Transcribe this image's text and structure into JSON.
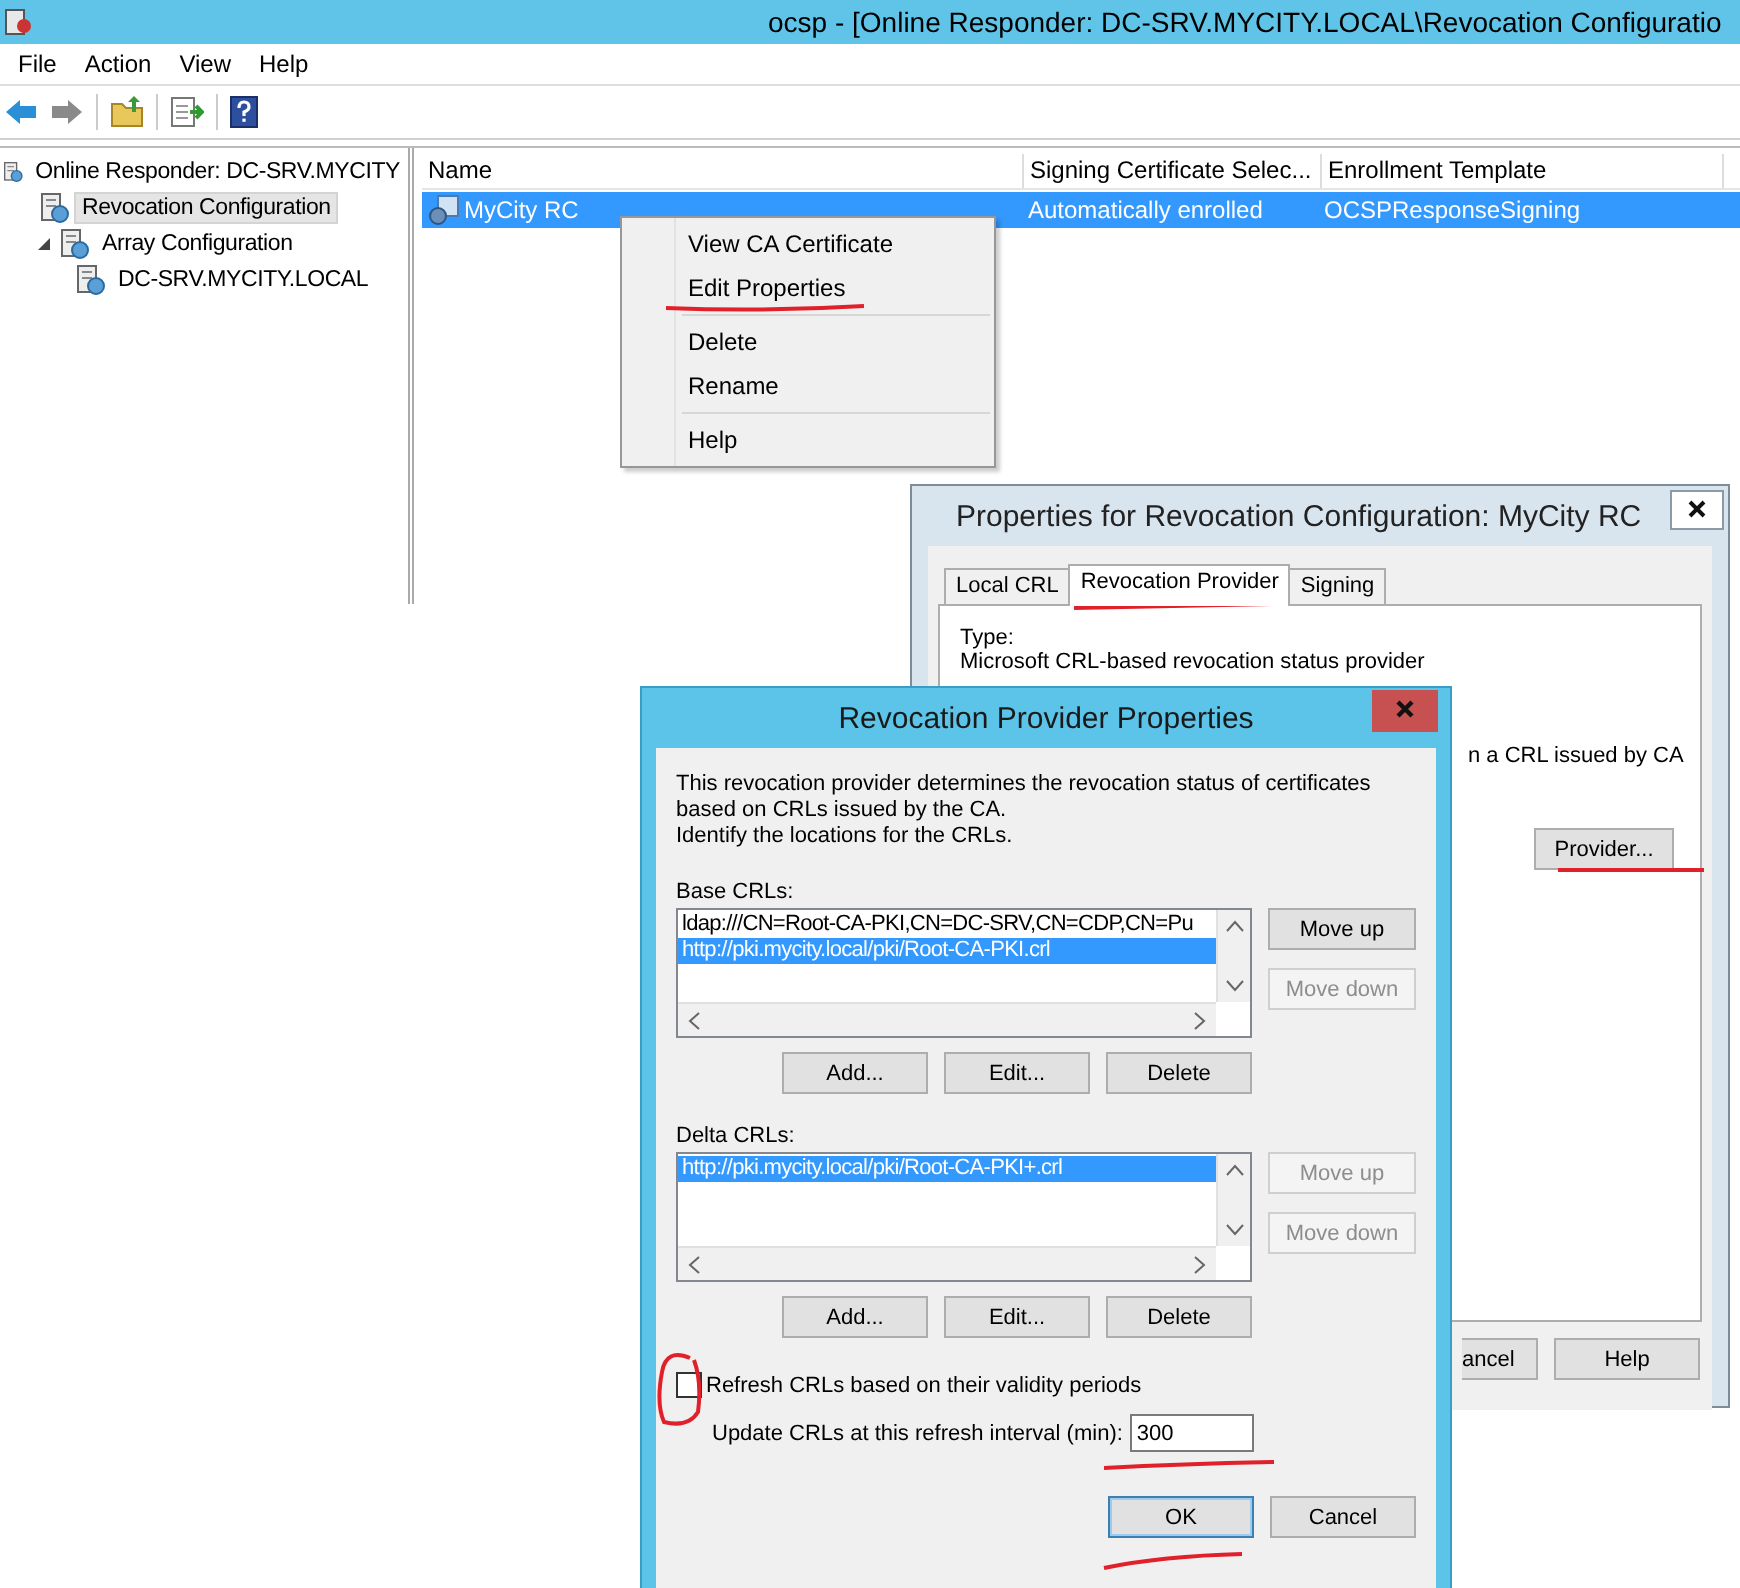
{
  "window": {
    "title": "ocsp - [Online Responder: DC-SRV.MYCITY.LOCAL\\Revocation Configuratio"
  },
  "menu": [
    "File",
    "Action",
    "View",
    "Help"
  ],
  "tree": [
    {
      "label": "Online Responder: DC-SRV.MYCITY",
      "selected": false,
      "children": [
        {
          "label": "Revocation Configuration",
          "selected": true
        },
        {
          "label": "Array Configuration",
          "selected": false,
          "expanded": true,
          "children": [
            {
              "label": "DC-SRV.MYCITY.LOCAL",
              "selected": false
            }
          ]
        }
      ]
    }
  ],
  "table": {
    "columns": [
      "Name",
      "Signing Certificate Selec...",
      "Enrollment Template"
    ],
    "rows": [
      {
        "cells": [
          "MyCity RC",
          "Automatically enrolled",
          "OCSPResponseSigning"
        ],
        "selected": true
      }
    ]
  },
  "context_menu": {
    "groups": [
      [
        "View CA Certificate",
        "Edit Properties"
      ],
      [
        "Delete",
        "Rename"
      ],
      [
        "Help"
      ]
    ]
  },
  "properties_dialog": {
    "title": "Properties for Revocation Configuration: MyCity RC",
    "tabs": [
      {
        "label": "Local CRL",
        "selected": false
      },
      {
        "label": "Revocation Provider",
        "selected": true
      },
      {
        "label": "Signing",
        "selected": false
      }
    ],
    "type_label": "Type:",
    "type_value": "Microsoft CRL-based revocation status provider",
    "partial_text": "n a CRL issued by CA",
    "provider_button": "Provider...",
    "buttons": [
      "ancel",
      "Help"
    ]
  },
  "provider_dialog": {
    "title": "Revocation Provider Properties",
    "description": "This revocation provider determines the revocation status of certificates\nbased on CRLs issued by the CA.\nIdentify the locations for the CRLs.",
    "lists": [
      {
        "label": "Base CRLs:",
        "items": [
          {
            "text": "ldap:///CN=Root-CA-PKI,CN=DC-SRV,CN=CDP,CN=Pu",
            "selected": false
          },
          {
            "text": "http://pki.mycity.local/pki/Root-CA-PKI.crl",
            "selected": true
          }
        ],
        "side_buttons": [
          {
            "label": "Move up",
            "disabled": false
          },
          {
            "label": "Move down",
            "disabled": true
          }
        ],
        "buttons": [
          "Add...",
          "Edit...",
          "Delete"
        ]
      },
      {
        "label": "Delta CRLs:",
        "items": [
          {
            "text": "http://pki.mycity.local/pki/Root-CA-PKI+.crl",
            "selected": true
          }
        ],
        "side_buttons": [
          {
            "label": "Move up",
            "disabled": true
          },
          {
            "label": "Move down",
            "disabled": true
          }
        ],
        "buttons": [
          "Add...",
          "Edit...",
          "Delete"
        ]
      }
    ],
    "refresh_checkbox": {
      "label": "Refresh CRLs based on their validity periods",
      "checked": false
    },
    "interval": {
      "label": "Update CRLs at this refresh interval (min):",
      "value": "300"
    },
    "buttons": [
      {
        "label": "OK",
        "default": true
      },
      {
        "label": "Cancel",
        "default": false
      }
    ]
  }
}
